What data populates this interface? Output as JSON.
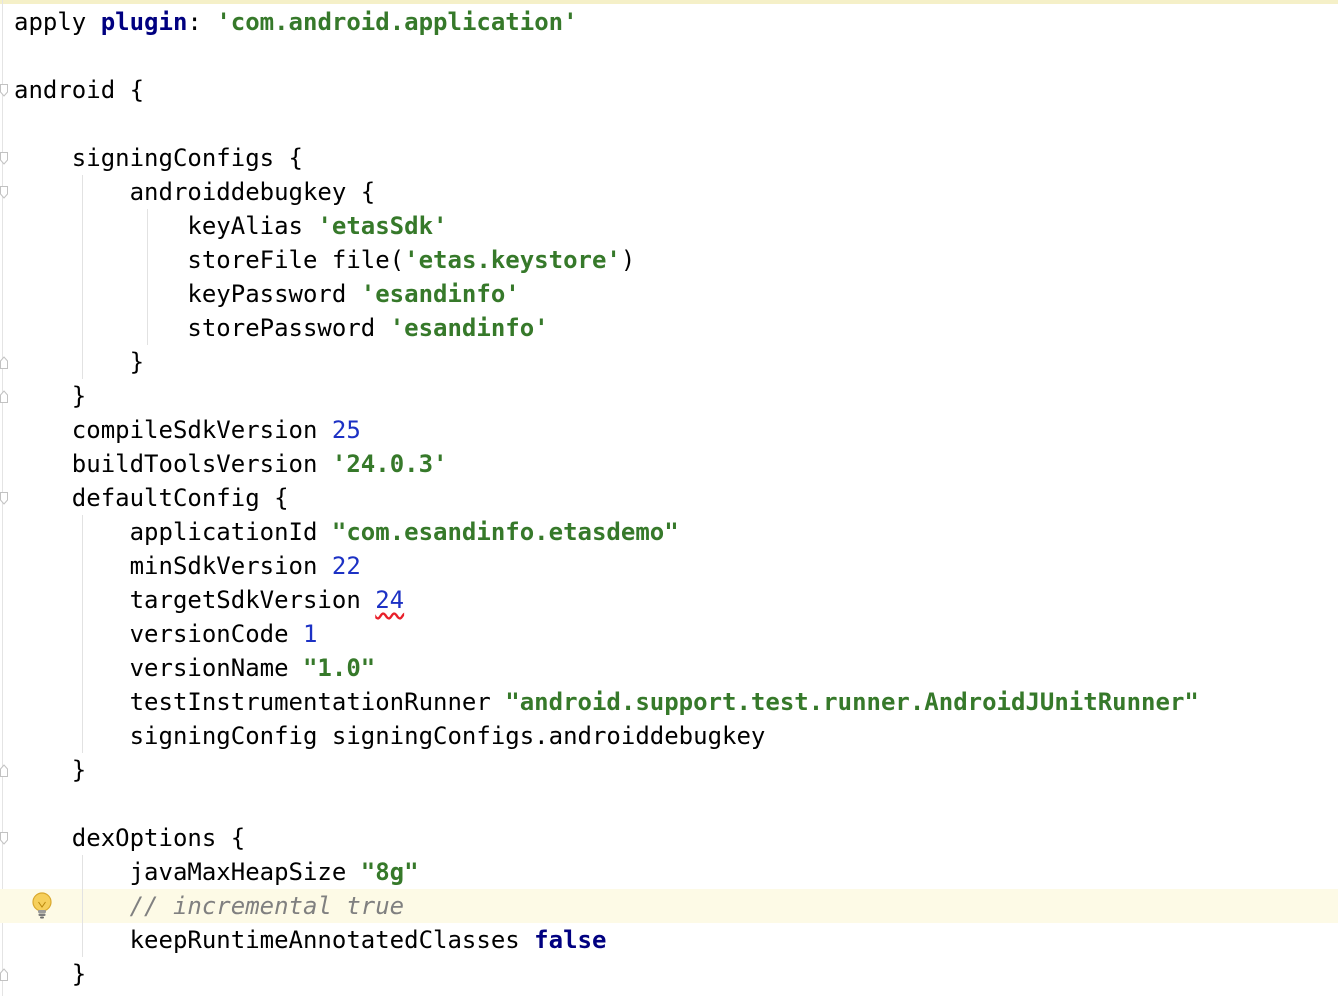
{
  "editor": {
    "language": "gradle",
    "colors": {
      "keyword": "#000080",
      "string": "#36792a",
      "number": "#1c31c4",
      "comment": "#808080",
      "current_line": "#fdfae6",
      "warning_underline": "#e8202a"
    },
    "current_line_index": 26,
    "lines": [
      [
        {
          "t": "apply "
        },
        {
          "t": "plugin",
          "c": "tok-plugin"
        },
        {
          "t": ": "
        },
        {
          "t": "'com.android.application'",
          "c": "tok-str"
        }
      ],
      [],
      [
        {
          "t": "android {"
        }
      ],
      [],
      [
        {
          "t": "    signingConfigs {"
        }
      ],
      [
        {
          "t": "        androiddebugkey {"
        }
      ],
      [
        {
          "t": "            keyAlias "
        },
        {
          "t": "'etasSdk'",
          "c": "tok-str"
        }
      ],
      [
        {
          "t": "            storeFile file("
        },
        {
          "t": "'etas.keystore'",
          "c": "tok-str"
        },
        {
          "t": ")"
        }
      ],
      [
        {
          "t": "            keyPassword "
        },
        {
          "t": "'esandinfo'",
          "c": "tok-str"
        }
      ],
      [
        {
          "t": "            storePassword "
        },
        {
          "t": "'esandinfo'",
          "c": "tok-str"
        }
      ],
      [
        {
          "t": "        }"
        }
      ],
      [
        {
          "t": "    }"
        }
      ],
      [
        {
          "t": "    compileSdkVersion "
        },
        {
          "t": "25",
          "c": "tok-num"
        }
      ],
      [
        {
          "t": "    buildToolsVersion "
        },
        {
          "t": "'24.0.3'",
          "c": "tok-str"
        }
      ],
      [
        {
          "t": "    defaultConfig {"
        }
      ],
      [
        {
          "t": "        applicationId "
        },
        {
          "t": "\"com.esandinfo.etasdemo\"",
          "c": "tok-str"
        }
      ],
      [
        {
          "t": "        minSdkVersion "
        },
        {
          "t": "22",
          "c": "tok-num"
        }
      ],
      [
        {
          "t": "        targetSdkVersion "
        },
        {
          "t": "24",
          "c": "tok-num tok-warn"
        }
      ],
      [
        {
          "t": "        versionCode "
        },
        {
          "t": "1",
          "c": "tok-num"
        }
      ],
      [
        {
          "t": "        versionName "
        },
        {
          "t": "\"1.0\"",
          "c": "tok-str"
        }
      ],
      [
        {
          "t": "        testInstrumentationRunner "
        },
        {
          "t": "\"android.support.test.runner.AndroidJUnitRunner\"",
          "c": "tok-str"
        }
      ],
      [
        {
          "t": "        signingConfig signingConfigs.androiddebugkey"
        }
      ],
      [
        {
          "t": "    }"
        }
      ],
      [],
      [
        {
          "t": "    dexOptions {"
        }
      ],
      [
        {
          "t": "        javaMaxHeapSize "
        },
        {
          "t": "\"8g\"",
          "c": "tok-str"
        }
      ],
      [
        {
          "t": "        "
        },
        {
          "t": "// incremental true",
          "c": "tok-cmt"
        }
      ],
      [
        {
          "t": "        keepRuntimeAnnotatedClasses "
        },
        {
          "t": "false",
          "c": "tok-kw"
        }
      ],
      [
        {
          "t": "    }"
        }
      ]
    ],
    "fold_markers": [
      {
        "line": 2,
        "kind": "open"
      },
      {
        "line": 4,
        "kind": "open"
      },
      {
        "line": 5,
        "kind": "open"
      },
      {
        "line": 10,
        "kind": "close"
      },
      {
        "line": 11,
        "kind": "close"
      },
      {
        "line": 14,
        "kind": "open"
      },
      {
        "line": 22,
        "kind": "close"
      },
      {
        "line": 24,
        "kind": "open"
      },
      {
        "line": 28,
        "kind": "close"
      }
    ],
    "indent_guides": [
      {
        "level": 1,
        "from_line": 4,
        "to_line": 11
      },
      {
        "level": 2,
        "from_line": 5,
        "to_line": 10
      },
      {
        "level": 1,
        "from_line": 14,
        "to_line": 22
      },
      {
        "level": 1,
        "from_line": 24,
        "to_line": 28
      }
    ],
    "intention_bulb": {
      "line": 26,
      "icon": "lightbulb-icon"
    }
  }
}
